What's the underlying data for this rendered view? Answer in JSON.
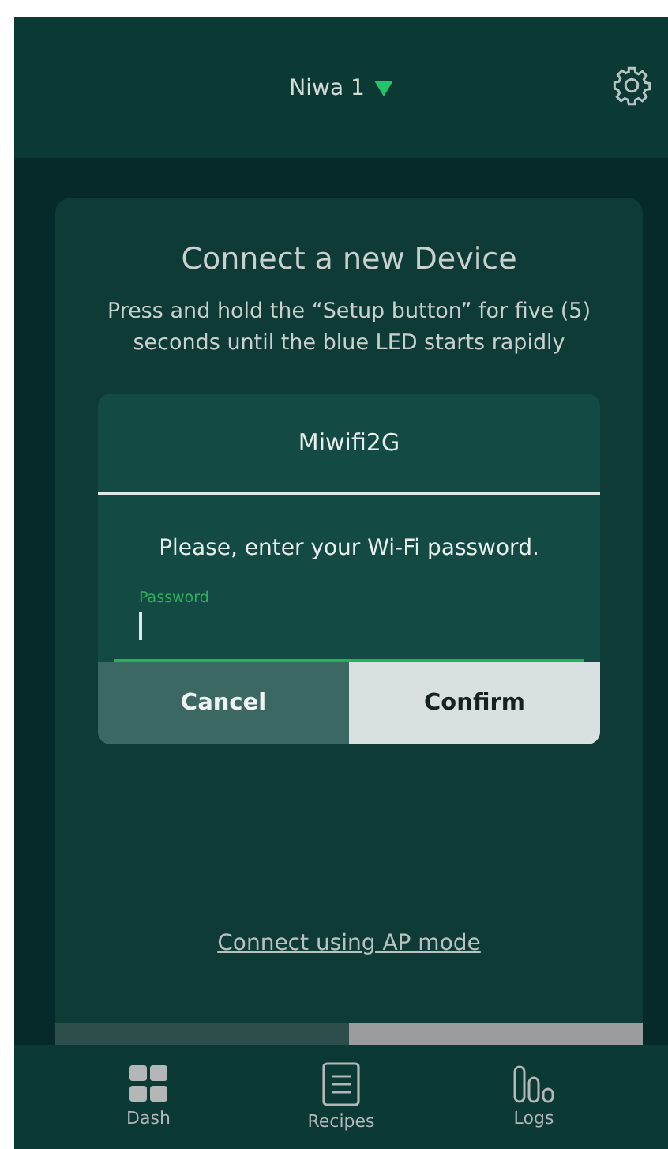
{
  "header": {
    "device": "Niwa 1"
  },
  "card": {
    "title": "Connect a new Device",
    "description": "Press and hold the “Setup button” for five (5) seconds until the blue LED starts rapidly",
    "link": "Connect using AP mode"
  },
  "dialog": {
    "title": "Miwifi2G",
    "message": "Please, enter your Wi-Fi password.",
    "field_label": "Password",
    "buttons": [
      {
        "label": "Cancel",
        "selected": false
      },
      {
        "label": "Confirm",
        "selected": true
      }
    ]
  },
  "nav": [
    {
      "label": "Dash",
      "kind": "dash"
    },
    {
      "label": "Recipes",
      "kind": "recipes"
    },
    {
      "label": "Logs",
      "kind": "logs"
    }
  ]
}
